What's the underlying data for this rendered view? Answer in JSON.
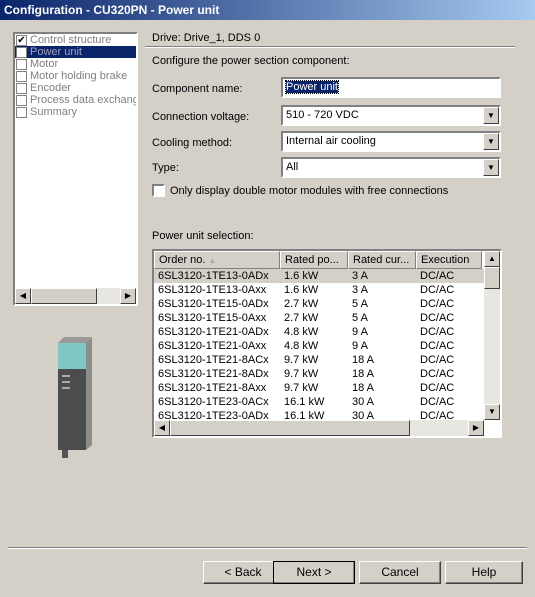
{
  "window": {
    "title": "Configuration - CU320PN - Power unit"
  },
  "nav": {
    "items": [
      {
        "label": "Control structure",
        "checked": true,
        "selected": false
      },
      {
        "label": "Power unit",
        "checked": false,
        "selected": true
      },
      {
        "label": "Motor",
        "checked": false,
        "selected": false
      },
      {
        "label": "Motor holding brake",
        "checked": false,
        "selected": false
      },
      {
        "label": "Encoder",
        "checked": false,
        "selected": false
      },
      {
        "label": "Process data exchang",
        "checked": false,
        "selected": false
      },
      {
        "label": "Summary",
        "checked": false,
        "selected": false
      }
    ]
  },
  "main": {
    "drive": "Drive: Drive_1, DDS 0",
    "instruction": "Configure the power section component:",
    "component_name_label": "Component name:",
    "component_name_value": "Power unit",
    "voltage_label": "Connection voltage:",
    "voltage_value": "510 - 720 VDC",
    "cooling_label": "Cooling method:",
    "cooling_value": "Internal air cooling",
    "type_label": "Type:",
    "type_value": "All",
    "double_motor_label": "Only display double motor modules with free connections",
    "double_motor_checked": false,
    "selection_label": "Power unit selection:",
    "columns": [
      "Order no.",
      "Rated po...",
      "Rated cur...",
      "Execution"
    ],
    "rows": [
      [
        "6SL3120-1TE13-0ADx",
        "1.6 kW",
        "3 A",
        "DC/AC"
      ],
      [
        "6SL3120-1TE13-0Axx",
        "1.6 kW",
        "3 A",
        "DC/AC"
      ],
      [
        "6SL3120-1TE15-0ADx",
        "2.7 kW",
        "5 A",
        "DC/AC"
      ],
      [
        "6SL3120-1TE15-0Axx",
        "2.7 kW",
        "5 A",
        "DC/AC"
      ],
      [
        "6SL3120-1TE21-0ADx",
        "4.8 kW",
        "9 A",
        "DC/AC"
      ],
      [
        "6SL3120-1TE21-0Axx",
        "4.8 kW",
        "9 A",
        "DC/AC"
      ],
      [
        "6SL3120-1TE21-8ACx",
        "9.7 kW",
        "18 A",
        "DC/AC"
      ],
      [
        "6SL3120-1TE21-8ADx",
        "9.7 kW",
        "18 A",
        "DC/AC"
      ],
      [
        "6SL3120-1TE21-8Axx",
        "9.7 kW",
        "18 A",
        "DC/AC"
      ],
      [
        "6SL3120-1TE23-0ACx",
        "16.1 kW",
        "30 A",
        "DC/AC"
      ],
      [
        "6SL3120-1TE23-0ADx",
        "16.1 kW",
        "30 A",
        "DC/AC"
      ]
    ],
    "selected_row": 0
  },
  "buttons": {
    "back": "< Back",
    "next": "Next >",
    "cancel": "Cancel",
    "help": "Help"
  }
}
